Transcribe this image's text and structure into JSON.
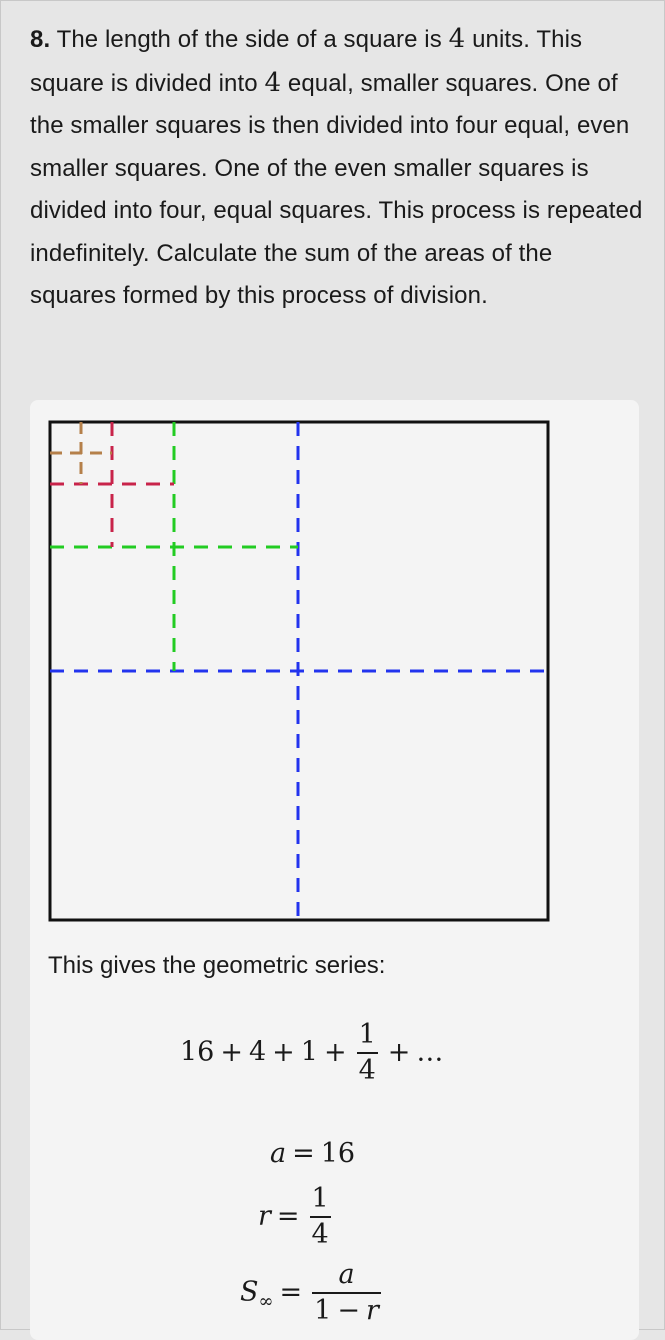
{
  "question": {
    "number": "8.",
    "line1_pre": "The length of the side of a square is",
    "side_value": "4",
    "line1_post": "units.",
    "line2_pre": "This square is divided into",
    "parts_value": "4",
    "line2_post": "equal, smaller squares. One of the smaller squares is then divided into four equal, even smaller squares. One of the even smaller squares is divided into four, equal squares. This process is repeated indefinitely. Calculate the sum of the areas of the squares formed by this process of division."
  },
  "diagram": {
    "colors": {
      "outline": "#111111",
      "level1": "#2233ee",
      "level2": "#22cc22",
      "level3": "#c8234a",
      "level4": "#b5804a"
    }
  },
  "solution": {
    "intro": "This gives the geometric series:",
    "series": {
      "t1": "16",
      "t2": "4",
      "t3": "1",
      "t4_num": "1",
      "t4_den": "4",
      "ellipsis": "…"
    },
    "a_def": {
      "var": "a",
      "value": "16"
    },
    "r_def": {
      "var": "r",
      "num": "1",
      "den": "4"
    },
    "s_def": {
      "var": "S",
      "sub": "∞",
      "num": "a",
      "den_1": "1",
      "den_r": "r"
    }
  }
}
